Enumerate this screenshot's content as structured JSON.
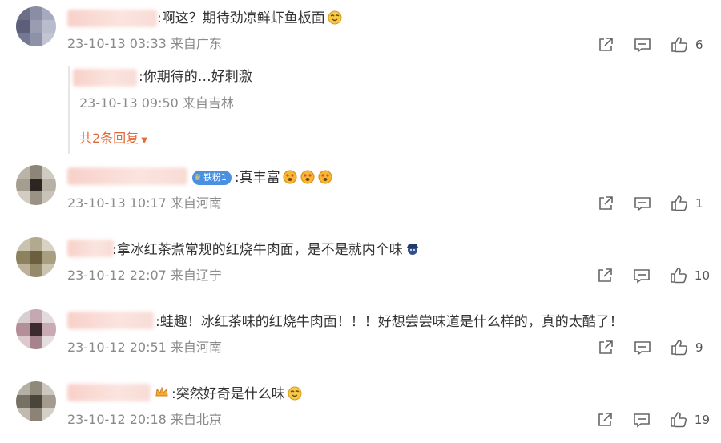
{
  "comments": [
    {
      "text": ":啊这？期待劲凉鲜虾鱼板面",
      "meta": "23-10-13 03:33 来自广东",
      "likes": "6",
      "reply": {
        "text": ":你期待的…好刺激",
        "meta": "23-10-13 09:50 来自吉林"
      },
      "more_replies": "共2条回复"
    },
    {
      "text": ":真丰富",
      "badge": "铁粉1",
      "meta": "23-10-13 10:17 来自河南",
      "likes": "1"
    },
    {
      "text": ":拿冰红茶煮常规的红烧牛肉面，是不是就内个味",
      "meta": "23-10-12 22:07 来自辽宁",
      "likes": "10"
    },
    {
      "text": ":蛙趣！冰红茶味的红烧牛肉面！！！好想尝尝味道是什么样的，真的太酷了！",
      "meta": "23-10-12 20:51 来自河南",
      "likes": "9"
    },
    {
      "text": ":突然好奇是什么味",
      "meta": "23-10-12 20:18 来自北京",
      "likes": "19"
    }
  ],
  "colors": {
    "link": "#e06a3b",
    "meta": "#8a8a8a",
    "badge": "#4a90e2"
  },
  "icons": [
    "share-icon",
    "comment-icon",
    "thumbs-up-icon",
    "emoji-icon"
  ]
}
